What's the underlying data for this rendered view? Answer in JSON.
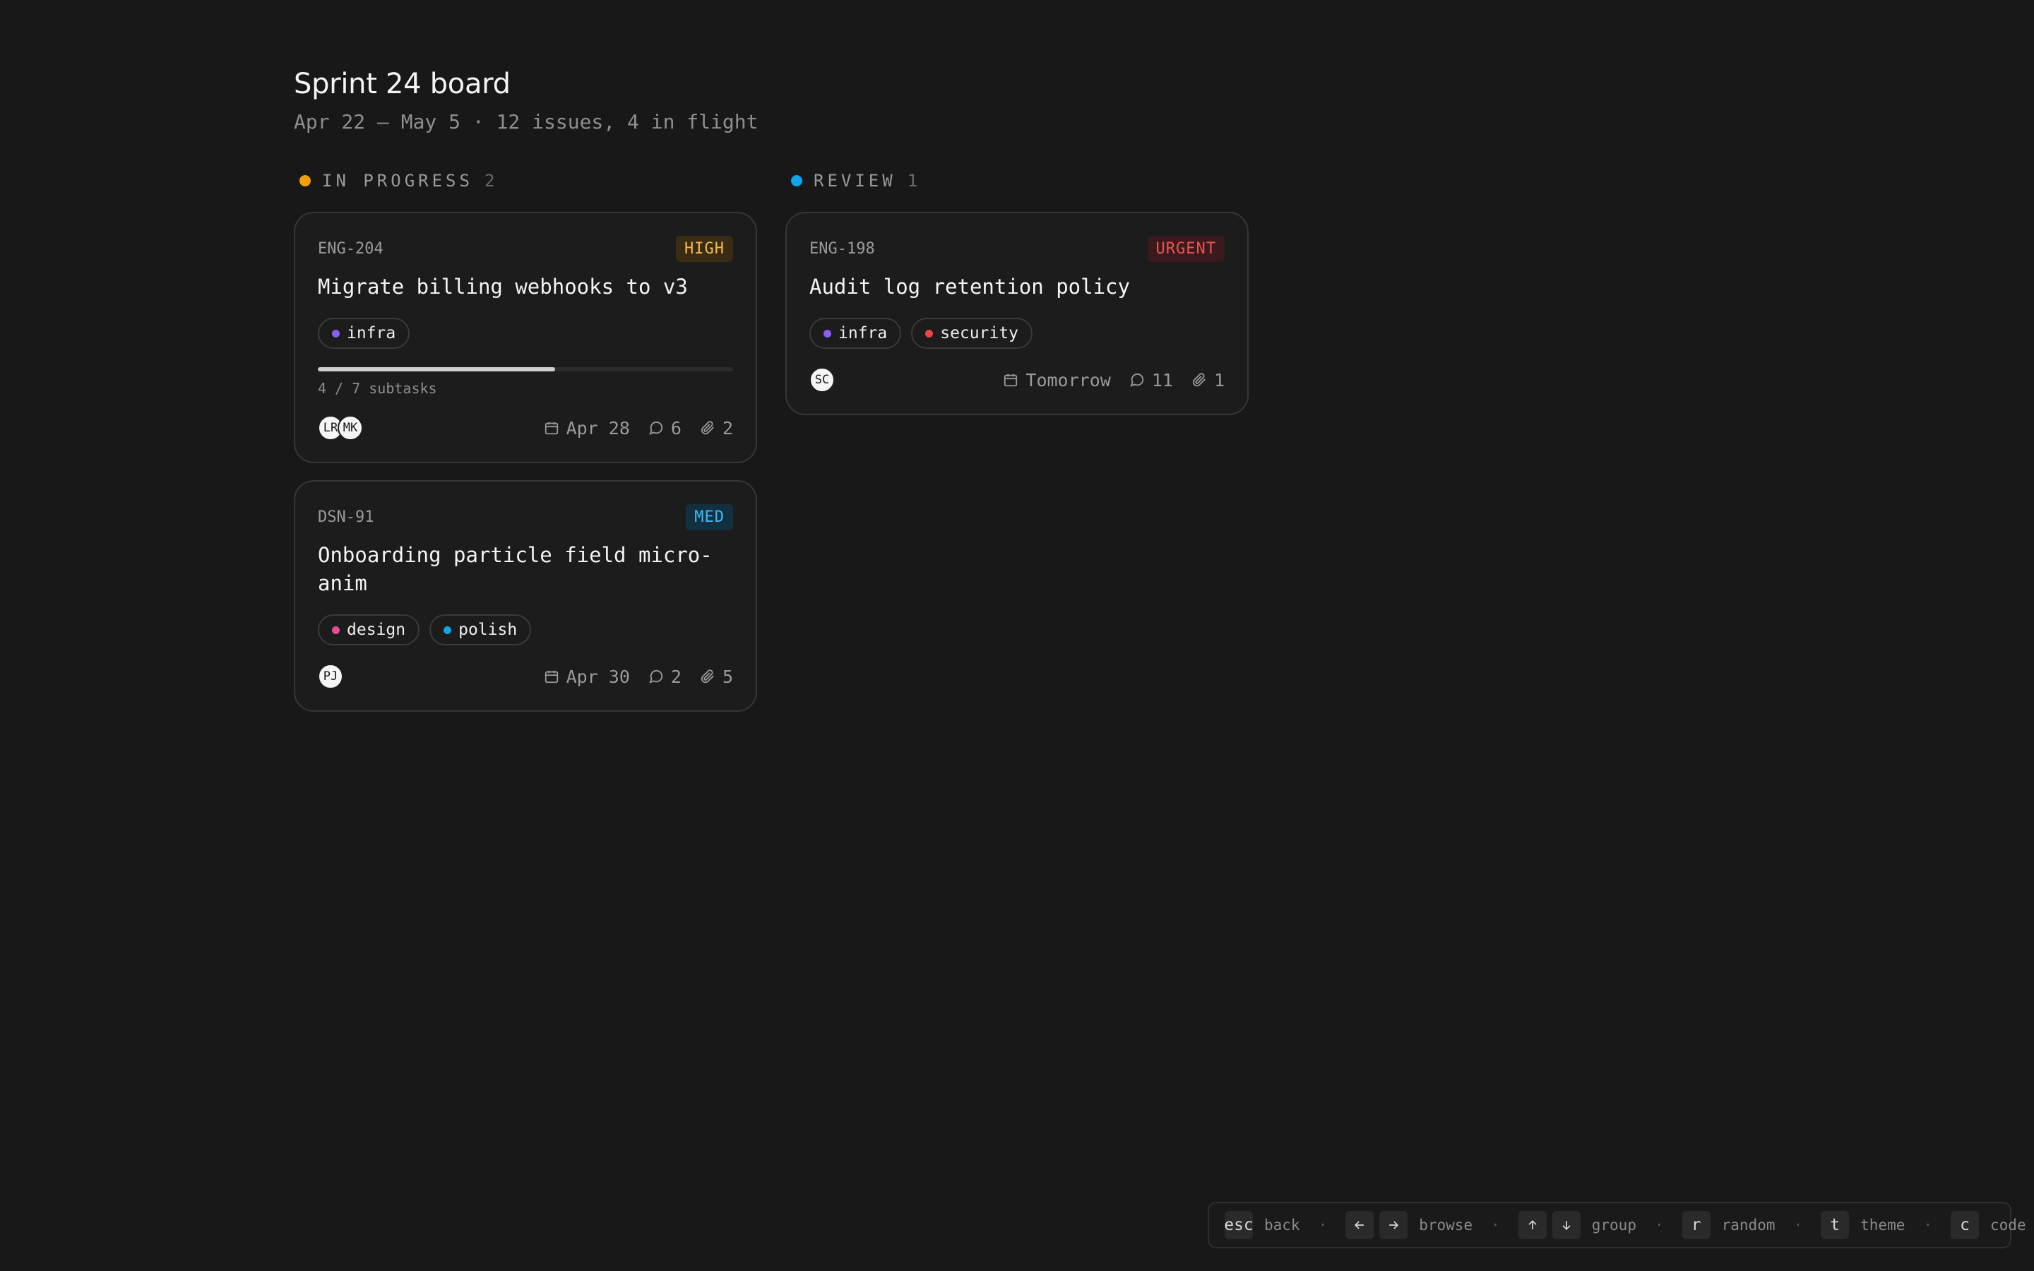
{
  "board": {
    "title": "Sprint 24 board",
    "subtitle": "Apr 22 – May 5 · 12 issues, 4 in flight"
  },
  "columns": [
    {
      "title": "IN PROGRESS",
      "count": "2",
      "color": "#f59e0b",
      "cards": [
        {
          "id": "ENG-204",
          "priority": "HIGH",
          "priority_color": "#f5b94a",
          "priority_bg": "#3a2c13",
          "title": "Migrate billing webhooks to v3",
          "tags": [
            {
              "label": "infra",
              "color": "#8b5cf6"
            }
          ],
          "progress": {
            "done": 4,
            "total": 7,
            "label": "4 / 7 subtasks"
          },
          "assignees": [
            "LR",
            "MK"
          ],
          "due": "Apr 28",
          "comments": "6",
          "attachments": "2"
        },
        {
          "id": "DSN-91",
          "priority": "MED",
          "priority_color": "#38bdf8",
          "priority_bg": "#12303f",
          "title": "Onboarding particle field micro-anim",
          "tags": [
            {
              "label": "design",
              "color": "#ec4899"
            },
            {
              "label": "polish",
              "color": "#0ea5e9"
            }
          ],
          "assignees": [
            "PJ"
          ],
          "due": "Apr 30",
          "comments": "2",
          "attachments": "5"
        }
      ]
    },
    {
      "title": "REVIEW",
      "count": "1",
      "color": "#0ea5e9",
      "cards": [
        {
          "id": "ENG-198",
          "priority": "URGENT",
          "priority_color": "#f05252",
          "priority_bg": "#3a1a1c",
          "title": "Audit log retention policy",
          "tags": [
            {
              "label": "infra",
              "color": "#8b5cf6"
            },
            {
              "label": "security",
              "color": "#ef4444"
            }
          ],
          "assignees": [
            "SC"
          ],
          "due": "Tomorrow",
          "comments": "11",
          "attachments": "1"
        }
      ]
    }
  ],
  "shortcuts": {
    "esc_key": "esc",
    "esc_label": "back",
    "browse_label": "browse",
    "group_label": "group",
    "random_key": "r",
    "random_label": "random",
    "theme_key": "t",
    "theme_label": "theme",
    "code_key": "c",
    "code_label": "code",
    "separator": "·"
  }
}
